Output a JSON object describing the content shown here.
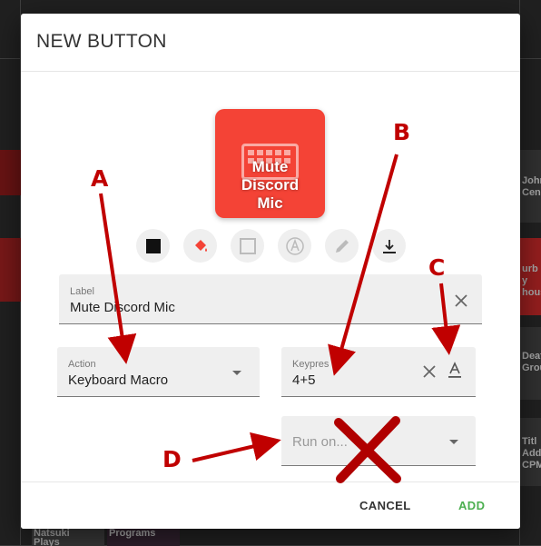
{
  "modal": {
    "title": "NEW BUTTON"
  },
  "preview": {
    "text_lines": [
      "Mute",
      "Discord",
      "Mic"
    ],
    "color": "#f44336",
    "icon": "keyboard-icon"
  },
  "style_tools": [
    {
      "name": "text-color-icon",
      "color": "#111111"
    },
    {
      "name": "fill-color-icon",
      "color": "#f44336"
    },
    {
      "name": "border-icon",
      "color": "#bbbbbb"
    },
    {
      "name": "font-icon",
      "color": "#bbbbbb"
    },
    {
      "name": "pen-icon",
      "color": "#bbbbbb"
    },
    {
      "name": "align-bottom-icon",
      "color": "#222222"
    }
  ],
  "label_field": {
    "label": "Label",
    "value": "Mute Discord Mic"
  },
  "action_field": {
    "label": "Action",
    "value": "Keyboard Macro"
  },
  "keypress_field": {
    "label": "Keypres",
    "value": "4+5"
  },
  "run_on_field": {
    "placeholder": "Run on..."
  },
  "footer": {
    "cancel": "CANCEL",
    "add": "ADD",
    "add_color": "#4caf50"
  },
  "annotations": {
    "a": "A",
    "b": "B",
    "c": "C",
    "d": "D",
    "color": "#c00000"
  },
  "background": {
    "tile_1": [
      "John",
      "Cen"
    ],
    "tile_2": [
      "urb y",
      "hous"
    ],
    "tile_3": [
      "Deat",
      "Grou"
    ],
    "tile_4": [
      "Titl",
      "Addi",
      "CPM"
    ],
    "tile_5": [
      "Natsuki",
      "Plays"
    ],
    "tile_6": [
      "Programs"
    ]
  }
}
